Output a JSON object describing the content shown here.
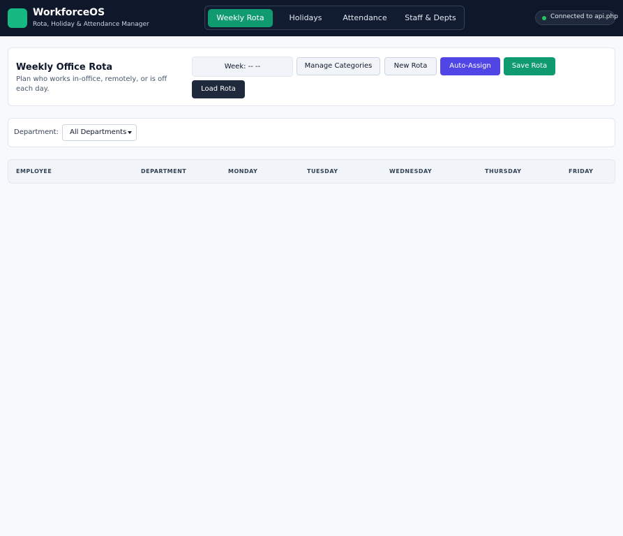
{
  "app": {
    "name": "WorkforceOS",
    "subtitle": "Rota, Holiday & Attendance Manager"
  },
  "nav": {
    "tabs": [
      {
        "label": "Weekly Rota",
        "active": true
      },
      {
        "label": "Holidays",
        "active": false
      },
      {
        "label": "Attendance",
        "active": false
      },
      {
        "label": "Staff & Depts",
        "active": false
      }
    ]
  },
  "connection": {
    "status": "Connected to api.php",
    "color": "#22c55e"
  },
  "rota": {
    "title": "Weekly Office Rota",
    "description": "Plan who works in-office, remotely, or is off each day.",
    "week_label": "Week: -- --",
    "buttons": {
      "manage_categories": "Manage Categories",
      "new_rota": "New Rota",
      "auto_assign": "Auto-Assign",
      "save_rota": "Save Rota",
      "load_rota": "Load Rota"
    }
  },
  "filter": {
    "label": "Department:",
    "selected": "All Departments"
  },
  "table": {
    "headers": [
      "EMPLOYEE",
      "DEPARTMENT",
      "MONDAY",
      "TUESDAY",
      "WEDNESDAY",
      "THURSDAY",
      "FRIDAY"
    ],
    "rows": []
  },
  "colors": {
    "brand": "#16b981",
    "accent_green": "#0f9a70",
    "accent_purple": "#4f46e5",
    "topbar": "#0f172a"
  }
}
